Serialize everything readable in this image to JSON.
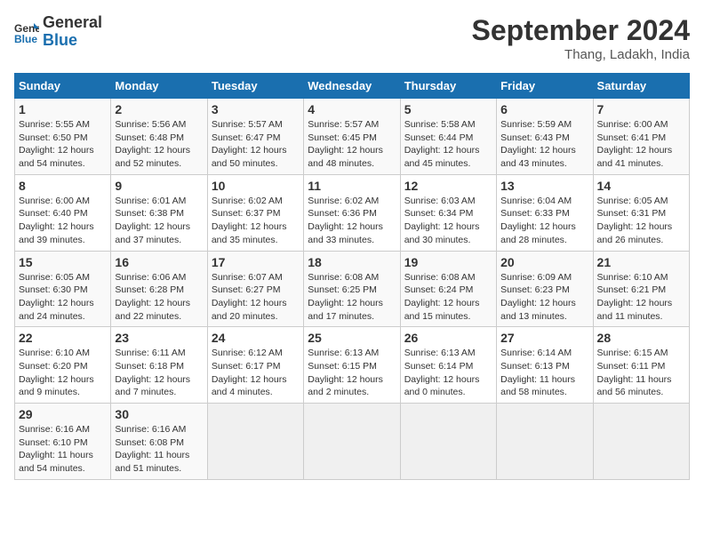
{
  "header": {
    "logo_general": "General",
    "logo_blue": "Blue",
    "month": "September 2024",
    "location": "Thang, Ladakh, India"
  },
  "columns": [
    "Sunday",
    "Monday",
    "Tuesday",
    "Wednesday",
    "Thursday",
    "Friday",
    "Saturday"
  ],
  "weeks": [
    [
      {
        "day": "1",
        "info": "Sunrise: 5:55 AM\nSunset: 6:50 PM\nDaylight: 12 hours\nand 54 minutes."
      },
      {
        "day": "2",
        "info": "Sunrise: 5:56 AM\nSunset: 6:48 PM\nDaylight: 12 hours\nand 52 minutes."
      },
      {
        "day": "3",
        "info": "Sunrise: 5:57 AM\nSunset: 6:47 PM\nDaylight: 12 hours\nand 50 minutes."
      },
      {
        "day": "4",
        "info": "Sunrise: 5:57 AM\nSunset: 6:45 PM\nDaylight: 12 hours\nand 48 minutes."
      },
      {
        "day": "5",
        "info": "Sunrise: 5:58 AM\nSunset: 6:44 PM\nDaylight: 12 hours\nand 45 minutes."
      },
      {
        "day": "6",
        "info": "Sunrise: 5:59 AM\nSunset: 6:43 PM\nDaylight: 12 hours\nand 43 minutes."
      },
      {
        "day": "7",
        "info": "Sunrise: 6:00 AM\nSunset: 6:41 PM\nDaylight: 12 hours\nand 41 minutes."
      }
    ],
    [
      {
        "day": "8",
        "info": "Sunrise: 6:00 AM\nSunset: 6:40 PM\nDaylight: 12 hours\nand 39 minutes."
      },
      {
        "day": "9",
        "info": "Sunrise: 6:01 AM\nSunset: 6:38 PM\nDaylight: 12 hours\nand 37 minutes."
      },
      {
        "day": "10",
        "info": "Sunrise: 6:02 AM\nSunset: 6:37 PM\nDaylight: 12 hours\nand 35 minutes."
      },
      {
        "day": "11",
        "info": "Sunrise: 6:02 AM\nSunset: 6:36 PM\nDaylight: 12 hours\nand 33 minutes."
      },
      {
        "day": "12",
        "info": "Sunrise: 6:03 AM\nSunset: 6:34 PM\nDaylight: 12 hours\nand 30 minutes."
      },
      {
        "day": "13",
        "info": "Sunrise: 6:04 AM\nSunset: 6:33 PM\nDaylight: 12 hours\nand 28 minutes."
      },
      {
        "day": "14",
        "info": "Sunrise: 6:05 AM\nSunset: 6:31 PM\nDaylight: 12 hours\nand 26 minutes."
      }
    ],
    [
      {
        "day": "15",
        "info": "Sunrise: 6:05 AM\nSunset: 6:30 PM\nDaylight: 12 hours\nand 24 minutes."
      },
      {
        "day": "16",
        "info": "Sunrise: 6:06 AM\nSunset: 6:28 PM\nDaylight: 12 hours\nand 22 minutes."
      },
      {
        "day": "17",
        "info": "Sunrise: 6:07 AM\nSunset: 6:27 PM\nDaylight: 12 hours\nand 20 minutes."
      },
      {
        "day": "18",
        "info": "Sunrise: 6:08 AM\nSunset: 6:25 PM\nDaylight: 12 hours\nand 17 minutes."
      },
      {
        "day": "19",
        "info": "Sunrise: 6:08 AM\nSunset: 6:24 PM\nDaylight: 12 hours\nand 15 minutes."
      },
      {
        "day": "20",
        "info": "Sunrise: 6:09 AM\nSunset: 6:23 PM\nDaylight: 12 hours\nand 13 minutes."
      },
      {
        "day": "21",
        "info": "Sunrise: 6:10 AM\nSunset: 6:21 PM\nDaylight: 12 hours\nand 11 minutes."
      }
    ],
    [
      {
        "day": "22",
        "info": "Sunrise: 6:10 AM\nSunset: 6:20 PM\nDaylight: 12 hours\nand 9 minutes."
      },
      {
        "day": "23",
        "info": "Sunrise: 6:11 AM\nSunset: 6:18 PM\nDaylight: 12 hours\nand 7 minutes."
      },
      {
        "day": "24",
        "info": "Sunrise: 6:12 AM\nSunset: 6:17 PM\nDaylight: 12 hours\nand 4 minutes."
      },
      {
        "day": "25",
        "info": "Sunrise: 6:13 AM\nSunset: 6:15 PM\nDaylight: 12 hours\nand 2 minutes."
      },
      {
        "day": "26",
        "info": "Sunrise: 6:13 AM\nSunset: 6:14 PM\nDaylight: 12 hours\nand 0 minutes."
      },
      {
        "day": "27",
        "info": "Sunrise: 6:14 AM\nSunset: 6:13 PM\nDaylight: 11 hours\nand 58 minutes."
      },
      {
        "day": "28",
        "info": "Sunrise: 6:15 AM\nSunset: 6:11 PM\nDaylight: 11 hours\nand 56 minutes."
      }
    ],
    [
      {
        "day": "29",
        "info": "Sunrise: 6:16 AM\nSunset: 6:10 PM\nDaylight: 11 hours\nand 54 minutes."
      },
      {
        "day": "30",
        "info": "Sunrise: 6:16 AM\nSunset: 6:08 PM\nDaylight: 11 hours\nand 51 minutes."
      },
      {
        "day": "",
        "info": ""
      },
      {
        "day": "",
        "info": ""
      },
      {
        "day": "",
        "info": ""
      },
      {
        "day": "",
        "info": ""
      },
      {
        "day": "",
        "info": ""
      }
    ]
  ]
}
